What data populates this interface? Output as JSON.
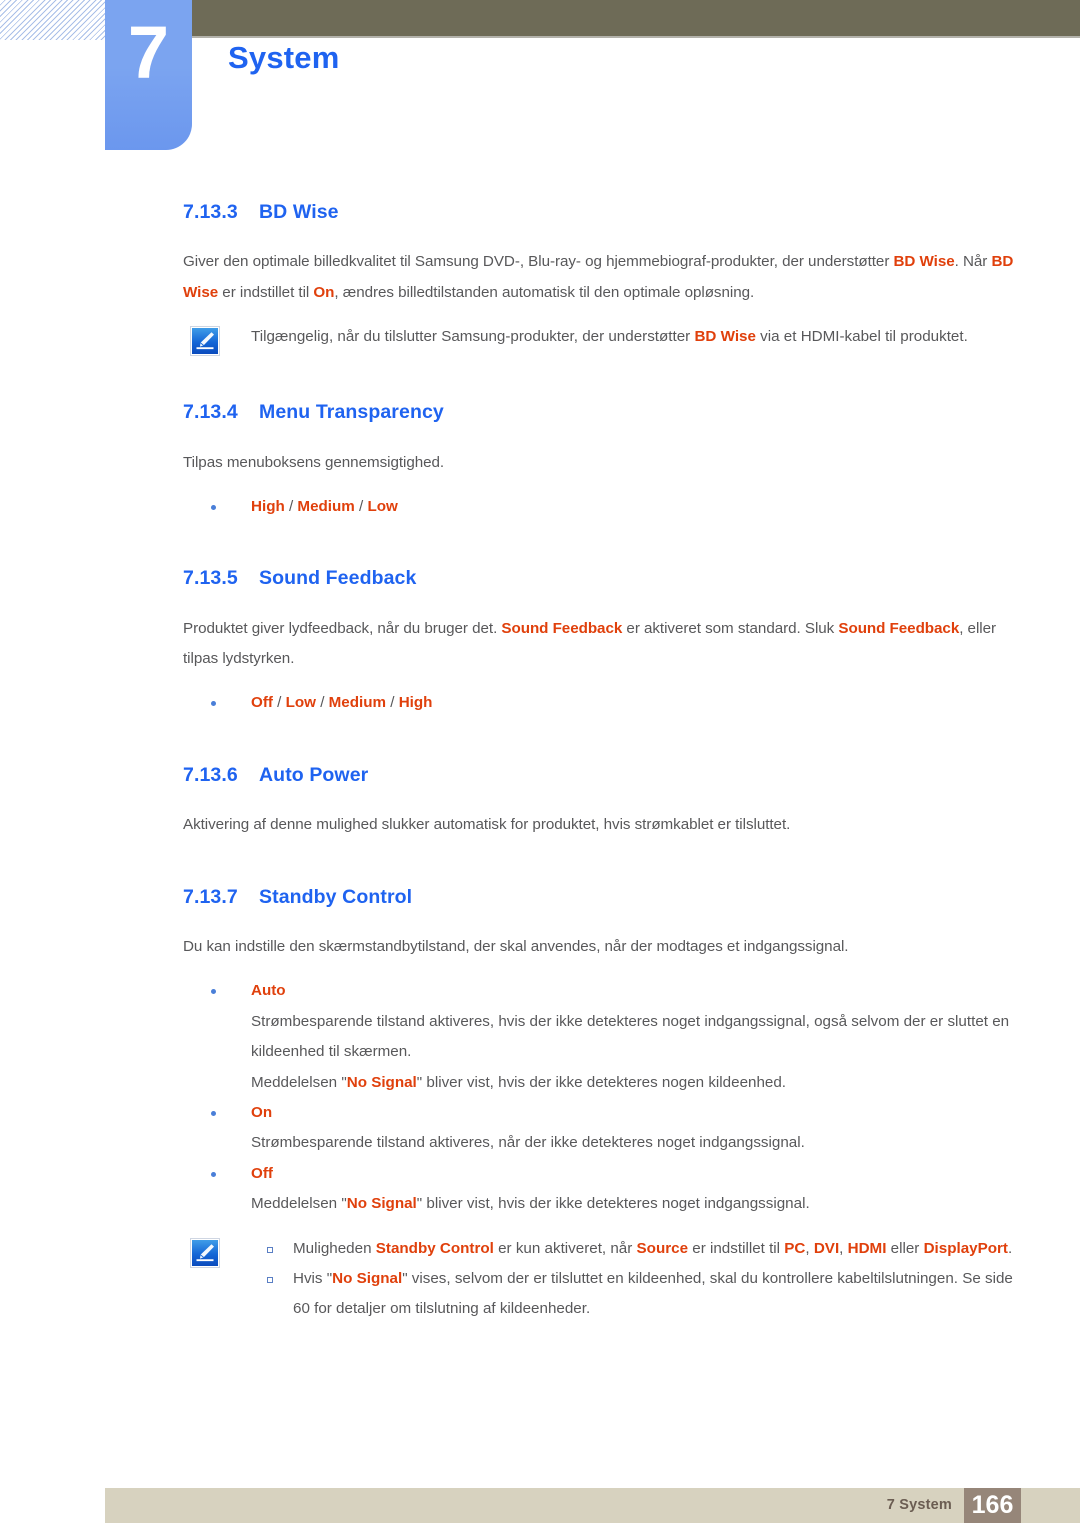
{
  "header": {
    "chapter_number": "7",
    "chapter_title": "System"
  },
  "sections": [
    {
      "number": "7.13.3",
      "title": "BD Wise",
      "paragraph_parts": [
        {
          "t": "Giver den optimale billedkvalitet til Samsung DVD-, Blu-ray- og hjemmebiograf-produkter, der understøtter ",
          "hl": false
        },
        {
          "t": "BD Wise",
          "hl": true
        },
        {
          "t": ". Når ",
          "hl": false
        },
        {
          "t": "BD Wise",
          "hl": true
        },
        {
          "t": " er indstillet til ",
          "hl": false
        },
        {
          "t": "On",
          "hl": true
        },
        {
          "t": ", ændres billedtilstanden automatisk til den optimale opløsning.",
          "hl": false
        }
      ],
      "note_parts": [
        {
          "t": "Tilgængelig, når du tilslutter Samsung-produkter, der understøtter ",
          "hl": false
        },
        {
          "t": "BD Wise",
          "hl": true
        },
        {
          "t": " via et HDMI-kabel til produktet.",
          "hl": false
        }
      ]
    },
    {
      "number": "7.13.4",
      "title": "Menu Transparency",
      "paragraph": "Tilpas menuboksens gennemsigtighed.",
      "options": [
        {
          "t": "High",
          "hl": true
        },
        {
          "t": " / ",
          "hl": false
        },
        {
          "t": "Medium",
          "hl": true
        },
        {
          "t": " / ",
          "hl": false
        },
        {
          "t": "Low",
          "hl": true
        }
      ]
    },
    {
      "number": "7.13.5",
      "title": "Sound Feedback",
      "paragraph_parts": [
        {
          "t": "Produktet giver lydfeedback, når du bruger det. ",
          "hl": false
        },
        {
          "t": "Sound Feedback",
          "hl": true
        },
        {
          "t": " er aktiveret som standard. Sluk ",
          "hl": false
        },
        {
          "t": "Sound Feedback",
          "hl": true
        },
        {
          "t": ", eller tilpas lydstyrken.",
          "hl": false
        }
      ],
      "options": [
        {
          "t": "Off",
          "hl": true
        },
        {
          "t": " / ",
          "hl": false
        },
        {
          "t": "Low",
          "hl": true
        },
        {
          "t": " / ",
          "hl": false
        },
        {
          "t": "Medium",
          "hl": true
        },
        {
          "t": " / ",
          "hl": false
        },
        {
          "t": "High",
          "hl": true
        }
      ]
    },
    {
      "number": "7.13.6",
      "title": "Auto Power",
      "paragraph": "Aktivering af denne mulighed slukker automatisk for produktet, hvis strømkablet er tilsluttet."
    },
    {
      "number": "7.13.7",
      "title": "Standby Control",
      "paragraph": "Du kan indstille den skærmstandbytilstand, der skal anvendes, når der modtages et indgangssignal.",
      "items": [
        {
          "label": "Auto",
          "paras": [
            [
              {
                "t": "Strømbesparende tilstand aktiveres, hvis der ikke detekteres noget indgangssignal, også selvom der er sluttet en kildeenhed til skærmen.",
                "hl": false
              }
            ],
            [
              {
                "t": "Meddelelsen \"",
                "hl": false
              },
              {
                "t": "No Signal",
                "hl": true
              },
              {
                "t": "\" bliver vist, hvis der ikke detekteres nogen kildeenhed.",
                "hl": false
              }
            ]
          ]
        },
        {
          "label": "On",
          "paras": [
            [
              {
                "t": "Strømbesparende tilstand aktiveres, når der ikke detekteres noget indgangssignal.",
                "hl": false
              }
            ]
          ]
        },
        {
          "label": "Off",
          "paras": [
            [
              {
                "t": "Meddelelsen \"",
                "hl": false
              },
              {
                "t": "No Signal",
                "hl": true
              },
              {
                "t": "\" bliver vist, hvis der ikke detekteres noget indgangssignal.",
                "hl": false
              }
            ]
          ]
        }
      ],
      "note_items": [
        [
          {
            "t": "Muligheden ",
            "hl": false
          },
          {
            "t": "Standby Control",
            "hl": true
          },
          {
            "t": " er kun aktiveret, når ",
            "hl": false
          },
          {
            "t": "Source",
            "hl": true
          },
          {
            "t": " er indstillet til ",
            "hl": false
          },
          {
            "t": "PC",
            "hl": true
          },
          {
            "t": ", ",
            "hl": false
          },
          {
            "t": "DVI",
            "hl": true
          },
          {
            "t": ", ",
            "hl": false
          },
          {
            "t": "HDMI",
            "hl": true
          },
          {
            "t": " eller ",
            "hl": false
          },
          {
            "t": "DisplayPort",
            "hl": true
          },
          {
            "t": ".",
            "hl": false
          }
        ],
        [
          {
            "t": "Hvis \"",
            "hl": false
          },
          {
            "t": "No Signal",
            "hl": true
          },
          {
            "t": "\" vises, selvom der er tilsluttet en kildeenhed, skal du kontrollere kabeltilslutningen. Se side 60 for detaljer om tilslutning af kildeenheder.",
            "hl": false
          }
        ]
      ]
    }
  ],
  "footer": {
    "label": "7 System",
    "page_number": "166"
  },
  "colors": {
    "heading_blue": "#1f63f0",
    "highlight_orange": "#e0400c",
    "body_gray": "#58585a",
    "olive_bar": "#6e6b57",
    "tab_blue": "#7ba4f0",
    "footer_band": "#d7d2bf",
    "footer_pagebox": "#968679"
  }
}
